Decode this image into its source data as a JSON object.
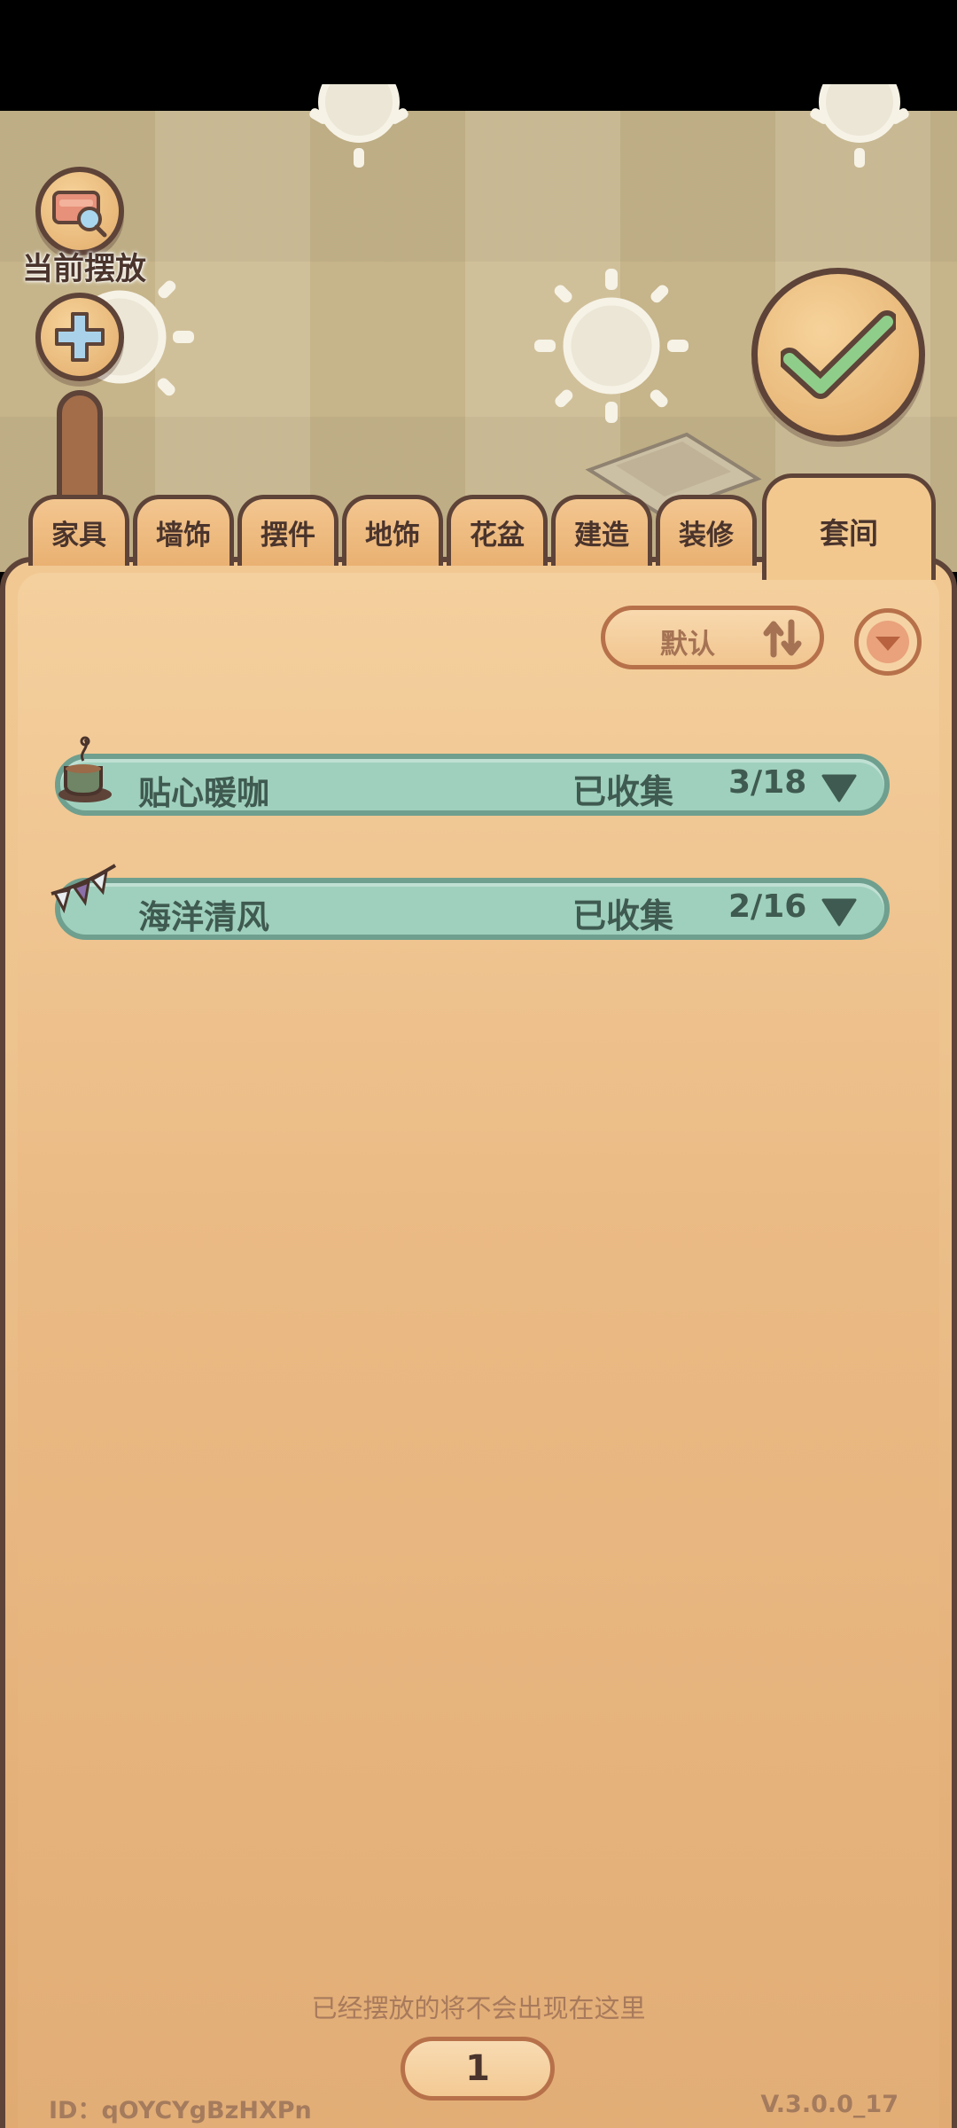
{
  "sidebar": {
    "current_placed_label": "当前摆放"
  },
  "tabs": [
    {
      "label": "家具"
    },
    {
      "label": "墙饰"
    },
    {
      "label": "摆件"
    },
    {
      "label": "地饰"
    },
    {
      "label": "花盆"
    },
    {
      "label": "建造"
    },
    {
      "label": "装修"
    },
    {
      "label": "套间",
      "active": true
    }
  ],
  "sort": {
    "label": "默认"
  },
  "sets": [
    {
      "name": "贴心暖咖",
      "collected_label": "已收集",
      "count": "3/18",
      "icon": "coffee-cup-icon"
    },
    {
      "name": "海洋清风",
      "collected_label": "已收集",
      "count": "2/16",
      "icon": "bunting-flags-icon"
    }
  ],
  "footer": {
    "note": "已经摆放的将不会出现在这里",
    "page": "1",
    "id": "ID：qOYCYgBzHXPn",
    "version": "V.3.0.0_17"
  },
  "colors": {
    "panel": "#f1c892",
    "outline": "#5e4338",
    "row": "#9fd0bd",
    "row_text": "#3f5a50",
    "check": "#8fce8a"
  }
}
